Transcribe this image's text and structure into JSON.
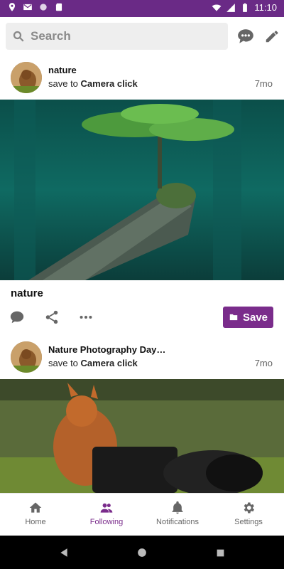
{
  "statusbar": {
    "time": "11:10"
  },
  "search": {
    "placeholder": "Search"
  },
  "posts": [
    {
      "title": "nature",
      "prefix": "save to",
      "board": "Camera click",
      "time": "7mo",
      "caption": "nature"
    },
    {
      "title": "Nature Photography Day…",
      "prefix": "save to",
      "board": "Camera click",
      "time": "7mo"
    }
  ],
  "actions": {
    "save_label": "Save"
  },
  "tabs": [
    {
      "label": "Home",
      "icon": "home-icon"
    },
    {
      "label": "Following",
      "icon": "people-icon"
    },
    {
      "label": "Notifications",
      "icon": "bell-icon"
    },
    {
      "label": "Settings",
      "icon": "gear-icon"
    }
  ],
  "colors": {
    "brand": "#7a2c8b",
    "statusbar": "#6a2a86"
  }
}
